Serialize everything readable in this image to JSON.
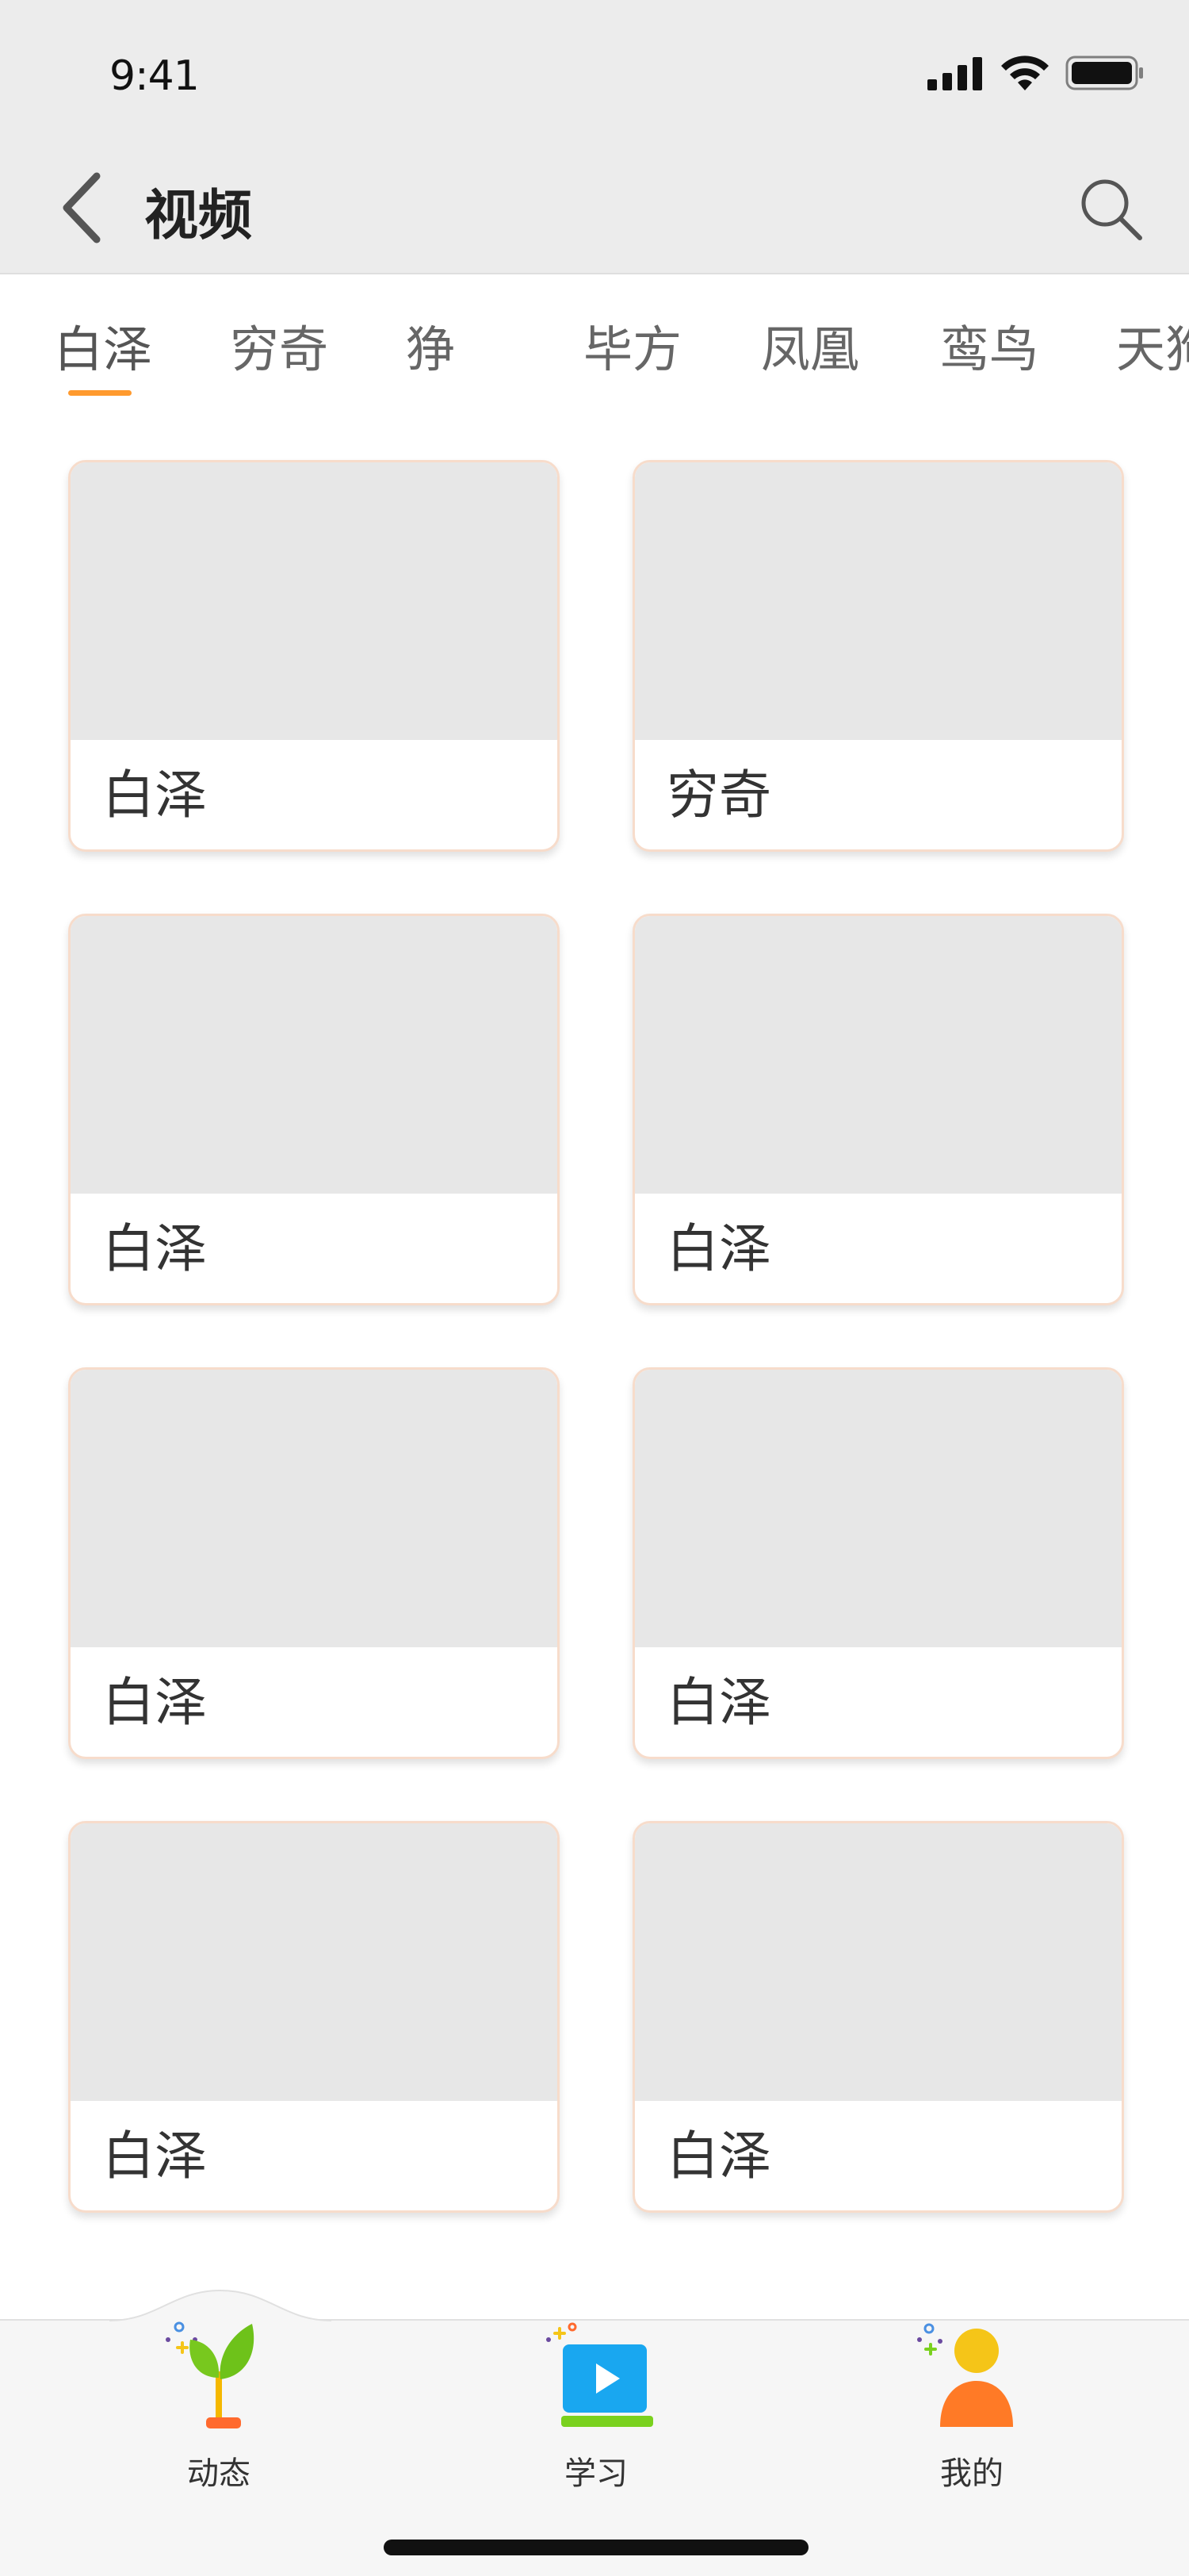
{
  "status_bar": {
    "time": "9:41"
  },
  "nav": {
    "title": "视频"
  },
  "tabs": [
    {
      "label": "白泽",
      "active": true
    },
    {
      "label": "穷奇",
      "active": false
    },
    {
      "label": "狰",
      "active": false
    },
    {
      "label": "毕方",
      "active": false
    },
    {
      "label": "凤凰",
      "active": false
    },
    {
      "label": "鸾鸟",
      "active": false
    },
    {
      "label": "天狗",
      "active": false
    }
  ],
  "cards": [
    {
      "label": "白泽"
    },
    {
      "label": "穷奇"
    },
    {
      "label": "白泽"
    },
    {
      "label": "白泽"
    },
    {
      "label": "白泽"
    },
    {
      "label": "白泽"
    },
    {
      "label": "白泽"
    },
    {
      "label": "白泽"
    }
  ],
  "tabbar": {
    "items": [
      {
        "label": "动态",
        "icon": "sprout-icon"
      },
      {
        "label": "学习",
        "icon": "play-video-icon"
      },
      {
        "label": "我的",
        "icon": "user-icon"
      }
    ]
  },
  "colors": {
    "accent": "#ff9a2e",
    "header_bg": "#ececec",
    "card_border": "#f7dccb",
    "thumb": "#e7e7e7"
  }
}
